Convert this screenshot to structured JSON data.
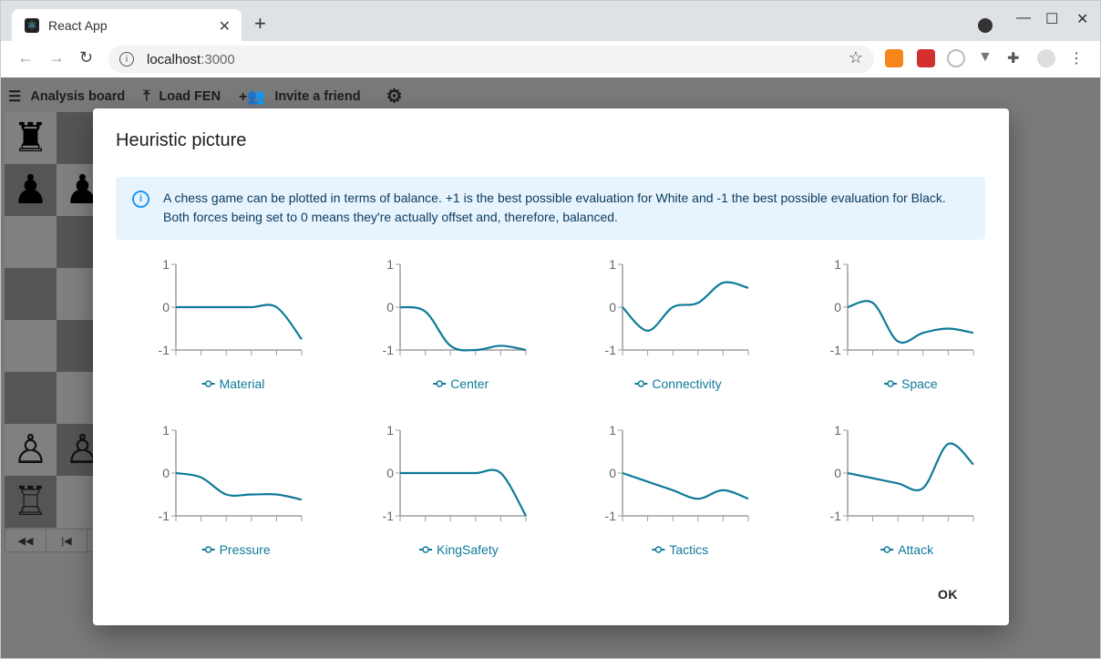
{
  "browser": {
    "tab_title": "React App",
    "url_host": "localhost",
    "url_port": ":3000"
  },
  "toolbar": {
    "analysis": "Analysis board",
    "load_fen": "Load FEN",
    "invite": "Invite a friend"
  },
  "dialog": {
    "title": "Heuristic picture",
    "info": "A chess game can be plotted in terms of balance. +1 is the best possible evaluation for White and -1 the best possible evaluation for Black. Both forces being set to 0 means they're actually offset and, therefore, balanced.",
    "ok": "OK"
  },
  "colors": {
    "line": "#0f7a99",
    "axis": "#9e9e9e",
    "info_bg": "#e8f4fd"
  },
  "chart_data": [
    {
      "type": "line",
      "name": "Material",
      "x": [
        0,
        1,
        2,
        3,
        4,
        5
      ],
      "values": [
        0,
        0,
        0,
        0,
        0,
        -0.75
      ],
      "ylim": [
        -1,
        1
      ],
      "yticks": [
        "1",
        "0",
        "-1"
      ]
    },
    {
      "type": "line",
      "name": "Center",
      "x": [
        0,
        1,
        2,
        3,
        4,
        5
      ],
      "values": [
        0,
        -0.1,
        -0.9,
        -1,
        -0.9,
        -1
      ],
      "ylim": [
        -1,
        1
      ],
      "yticks": [
        "1",
        "0",
        "-1"
      ]
    },
    {
      "type": "line",
      "name": "Connectivity",
      "x": [
        0,
        1,
        2,
        3,
        4,
        5
      ],
      "values": [
        0,
        -0.55,
        0,
        0.1,
        0.57,
        0.45
      ],
      "ylim": [
        -1,
        1
      ],
      "yticks": [
        "1",
        "0",
        "-1"
      ]
    },
    {
      "type": "line",
      "name": "Space",
      "x": [
        0,
        1,
        2,
        3,
        4,
        5
      ],
      "values": [
        0,
        0.1,
        -0.8,
        -0.6,
        -0.5,
        -0.6
      ],
      "ylim": [
        -1,
        1
      ],
      "yticks": [
        "1",
        "0",
        "-1"
      ]
    },
    {
      "type": "line",
      "name": "Pressure",
      "x": [
        0,
        1,
        2,
        3,
        4,
        5
      ],
      "values": [
        0,
        -0.1,
        -0.5,
        -0.5,
        -0.5,
        -0.62
      ],
      "ylim": [
        -1,
        1
      ],
      "yticks": [
        "1",
        "0",
        "-1"
      ]
    },
    {
      "type": "line",
      "name": "KingSafety",
      "x": [
        0,
        1,
        2,
        3,
        4,
        5
      ],
      "values": [
        0,
        0,
        0,
        0,
        0,
        -1
      ],
      "ylim": [
        -1,
        1
      ],
      "yticks": [
        "1",
        "0",
        "-1"
      ]
    },
    {
      "type": "line",
      "name": "Tactics",
      "x": [
        0,
        1,
        2,
        3,
        4,
        5
      ],
      "values": [
        0,
        -0.2,
        -0.4,
        -0.6,
        -0.4,
        -0.6
      ],
      "ylim": [
        -1,
        1
      ],
      "yticks": [
        "1",
        "0",
        "-1"
      ]
    },
    {
      "type": "line",
      "name": "Attack",
      "x": [
        0,
        1,
        2,
        3,
        4,
        5
      ],
      "values": [
        0,
        -0.12,
        -0.24,
        -0.35,
        0.68,
        0.2
      ],
      "ylim": [
        -1,
        1
      ],
      "yticks": [
        "1",
        "0",
        "-1"
      ]
    }
  ]
}
